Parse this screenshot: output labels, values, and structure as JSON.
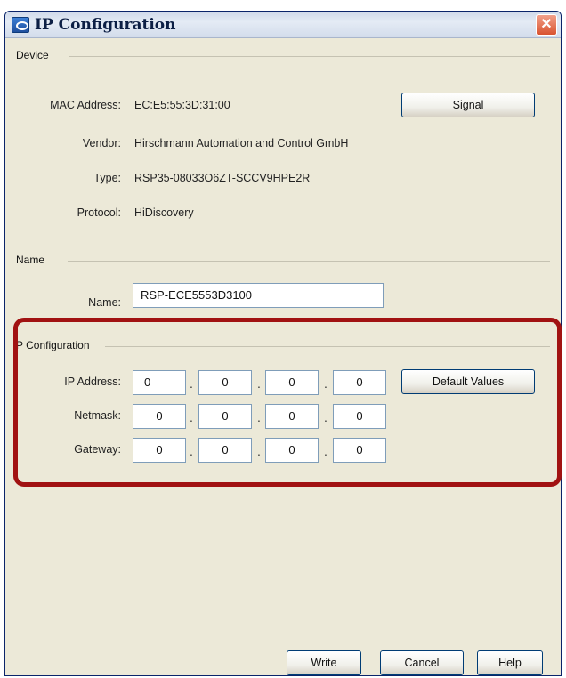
{
  "window": {
    "title": "IP Configuration",
    "close_glyph": "✕"
  },
  "device": {
    "section": "Device",
    "mac_label": "MAC Address:",
    "mac_value": "EC:E5:55:3D:31:00",
    "vendor_label": "Vendor:",
    "vendor_value": "Hirschmann Automation and Control GmbH",
    "type_label": "Type:",
    "type_value": "RSP35-08033O6ZT-SCCV9HPE2R",
    "protocol_label": "Protocol:",
    "protocol_value": "HiDiscovery",
    "signal_button": "Signal"
  },
  "name_section": {
    "section": "Name",
    "name_label": "Name:",
    "name_value": "RSP-ECE5553D3100"
  },
  "ip_config": {
    "section": "P Configuration",
    "ip_label": "IP Address:",
    "netmask_label": "Netmask:",
    "gateway_label": "Gateway:",
    "ip": [
      "0",
      "0",
      "0",
      "0"
    ],
    "netmask": [
      "0",
      "0",
      "0",
      "0"
    ],
    "gateway": [
      "0",
      "0",
      "0",
      "0"
    ],
    "dot": ".",
    "default_button": "Default Values"
  },
  "footer": {
    "write": "Write",
    "cancel": "Cancel",
    "help": "Help"
  },
  "colors": {
    "highlight": "#a11212",
    "titlebar": "#dfe6f1",
    "panel": "#ece9d8"
  },
  "icons": {
    "title_icon": "network-eye-icon",
    "close_icon": "close-icon"
  }
}
